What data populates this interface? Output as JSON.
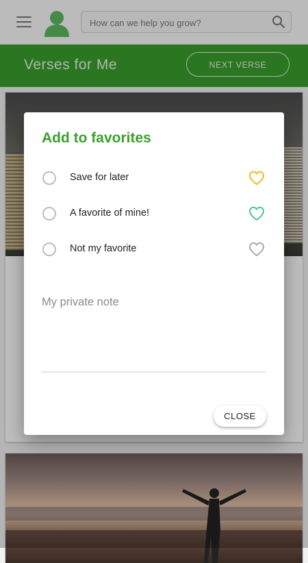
{
  "header": {
    "search_placeholder": "How can we help you grow?",
    "menu_icon": "hamburger-menu-icon",
    "avatar_icon": "user-avatar-icon",
    "search_icon": "search-icon"
  },
  "banner": {
    "title": "Verses for Me",
    "next_verse_label": "NEXT VERSE",
    "background_color": "#3a9e2b"
  },
  "dialog": {
    "title": "Add to favorites",
    "title_color": "#39a12b",
    "options": [
      {
        "label": "Save for later",
        "heart_color": "#f2b81d"
      },
      {
        "label": "A favorite of mine!",
        "heart_color": "#4cc49a"
      },
      {
        "label": "Not my favorite",
        "heart_color": "#aaaaaa"
      }
    ],
    "note_placeholder": "My private note",
    "close_label": "CLOSE"
  }
}
